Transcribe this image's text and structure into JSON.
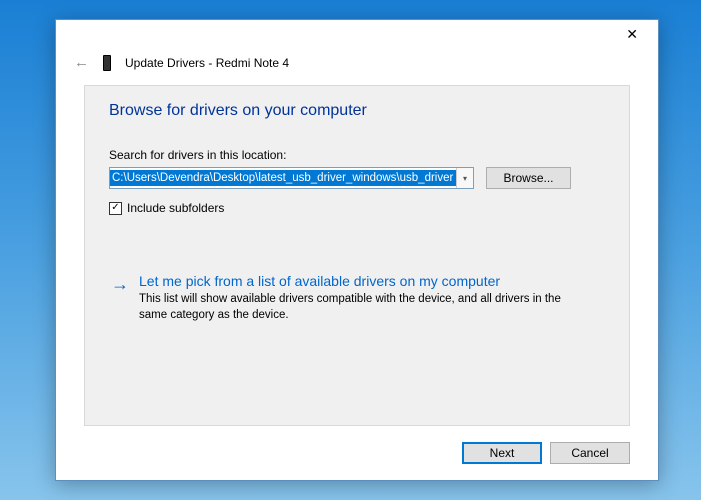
{
  "titlebar": {
    "close": "✕"
  },
  "header": {
    "back": "←",
    "title": "Update Drivers - Redmi Note 4"
  },
  "panel": {
    "heading": "Browse for drivers on your computer",
    "search_label": "Search for drivers in this location:",
    "path_value": "C:\\Users\\Devendra\\Desktop\\latest_usb_driver_windows\\usb_driver",
    "browse_btn": "Browse...",
    "include_subfolders": "Include subfolders",
    "checkmark": "✓",
    "pick_arrow": "→",
    "pick_title": "Let me pick from a list of available drivers on my computer",
    "pick_desc": "This list will show available drivers compatible with the device, and all drivers in the same category as the device."
  },
  "buttons": {
    "next": "Next",
    "cancel": "Cancel"
  }
}
